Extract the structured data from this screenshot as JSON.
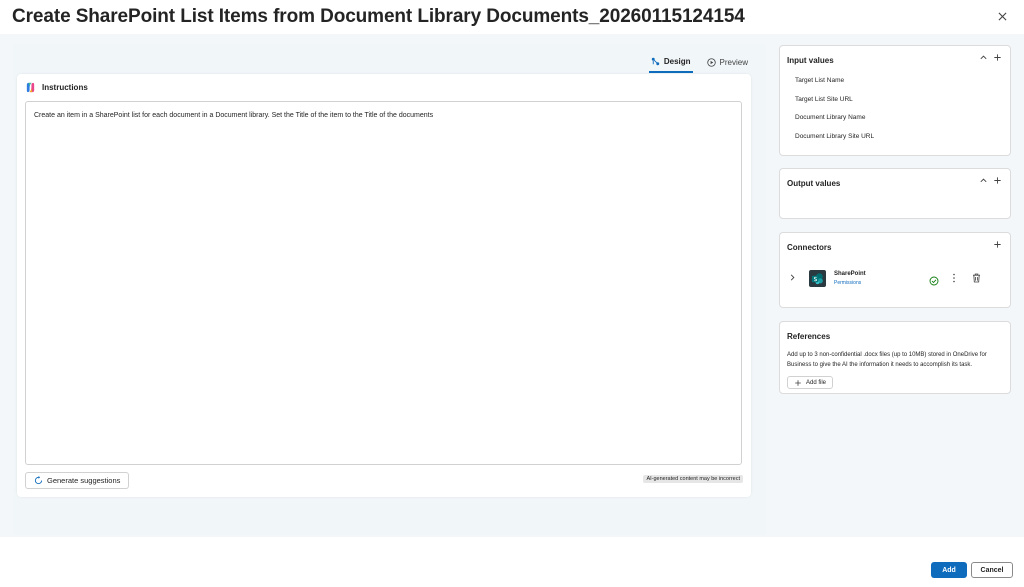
{
  "dialog": {
    "title": "Create SharePoint List Items from Document Library Documents_20260115124154"
  },
  "mode_tabs": {
    "design": "Design",
    "preview": "Preview"
  },
  "instructions": {
    "title": "Instructions",
    "text": "Create an item in a SharePoint list for each document in a Document library. Set the Title of the item to the Title of the documents",
    "generate_label": "Generate suggestions",
    "ai_note": "AI-generated content may be incorrect"
  },
  "input_values": {
    "title": "Input values",
    "items": [
      "Target List Name",
      "Target List Site URL",
      "Document Library Name",
      "Document Library Site URL"
    ]
  },
  "output_values": {
    "title": "Output values"
  },
  "connectors": {
    "title": "Connectors",
    "items": [
      {
        "name": "SharePoint",
        "permissions_label": "Permissions"
      }
    ]
  },
  "references": {
    "title": "References",
    "description": "Add up to 3 non-confidential .docx files (up to 10MB) stored in OneDrive for Business to give the AI the information it needs to accomplish its task.",
    "add_file_label": "Add file"
  },
  "footer": {
    "add_label": "Add",
    "cancel_label": "Cancel"
  },
  "colors": {
    "accent": "#0f6cbd",
    "success": "#107c10"
  }
}
